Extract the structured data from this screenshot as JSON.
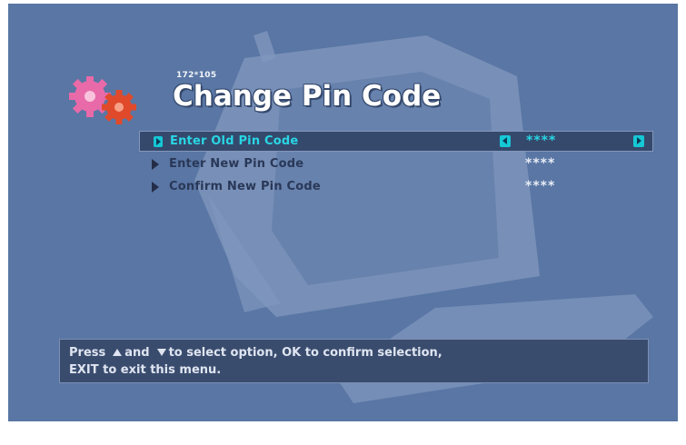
{
  "header": {
    "page_code": "172*105",
    "title": "Change Pin Code"
  },
  "menu": {
    "items": [
      {
        "label": "Enter Old Pin Code",
        "value": "****",
        "selected": true
      },
      {
        "label": "Enter New Pin Code",
        "value": "****",
        "selected": false
      },
      {
        "label": "Confirm New Pin Code",
        "value": "****",
        "selected": false
      }
    ]
  },
  "help": {
    "press": "Press",
    "and": "and",
    "rest_line1": "to select option, OK to confirm selection,",
    "line2": "EXIT to exit this menu."
  },
  "icons": {
    "gears": "gears-icon",
    "selector_left": "arrow-left-icon",
    "selector_right": "arrow-right-icon",
    "item_marker": "arrow-right-icon",
    "up": "triangle-up-icon",
    "down": "triangle-down-icon"
  },
  "colors": {
    "background": "#5976a4",
    "highlight": "#29d6e4",
    "panel": "#35496c",
    "gear_pink": "#e86aa8",
    "gear_red": "#e04a2a"
  }
}
